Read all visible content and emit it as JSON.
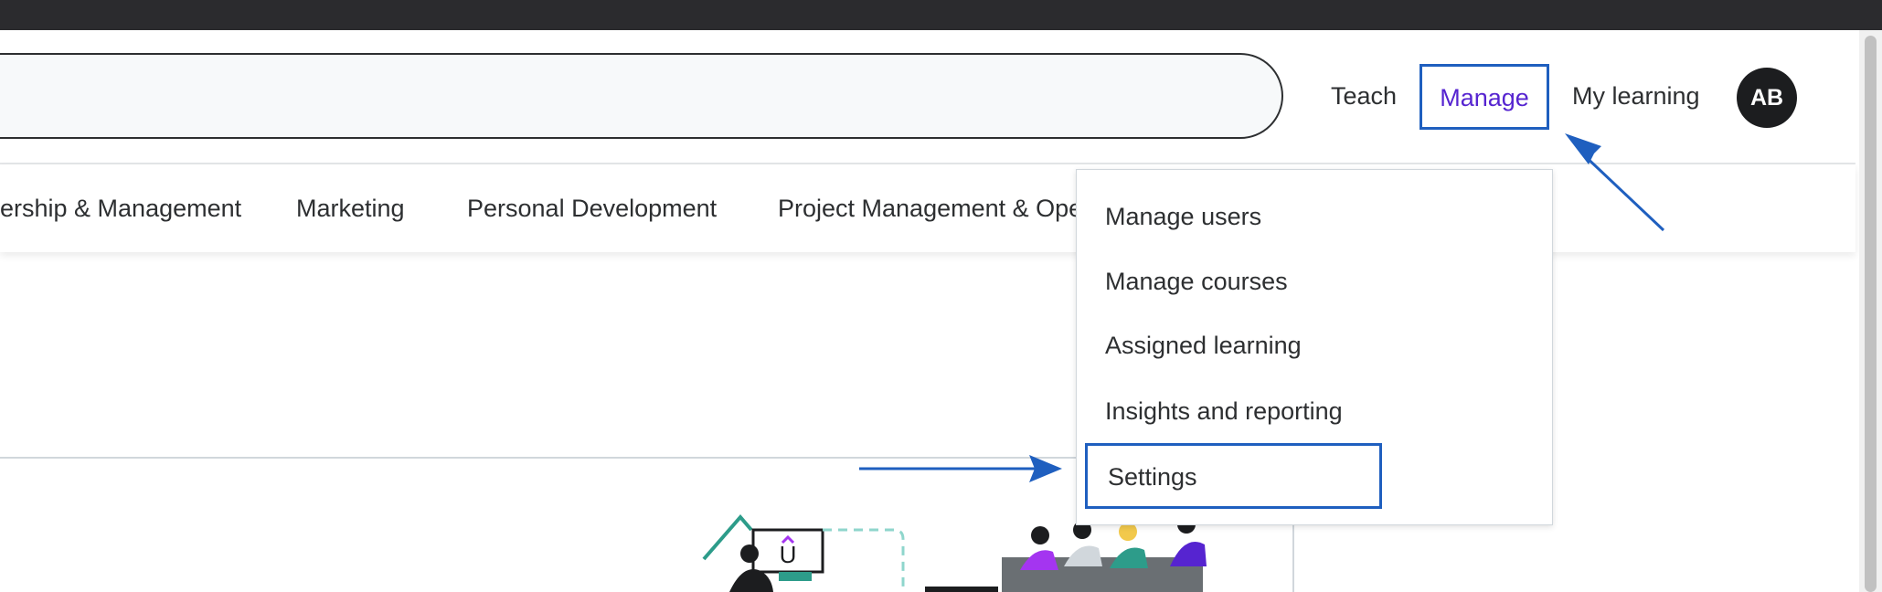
{
  "header": {
    "nav": {
      "teach": "Teach",
      "manage": "Manage",
      "my_learning": "My learning"
    },
    "avatar_initials": "AB"
  },
  "categories": [
    "ership & Management",
    "Marketing",
    "Personal Development",
    "Project Management & Ope"
  ],
  "manage_menu": {
    "items": [
      "Manage users",
      "Manage courses",
      "Assigned learning",
      "Insights and reporting",
      "Settings"
    ]
  },
  "colors": {
    "accent_purple": "#5624d0",
    "highlight_blue": "#1f5fbf",
    "top_bar": "#2b2b2e",
    "avatar_bg": "#1c1d1f"
  },
  "icons": {
    "annotation_arrows": "arrow-icon",
    "illustration": "team-learning-illustration"
  }
}
